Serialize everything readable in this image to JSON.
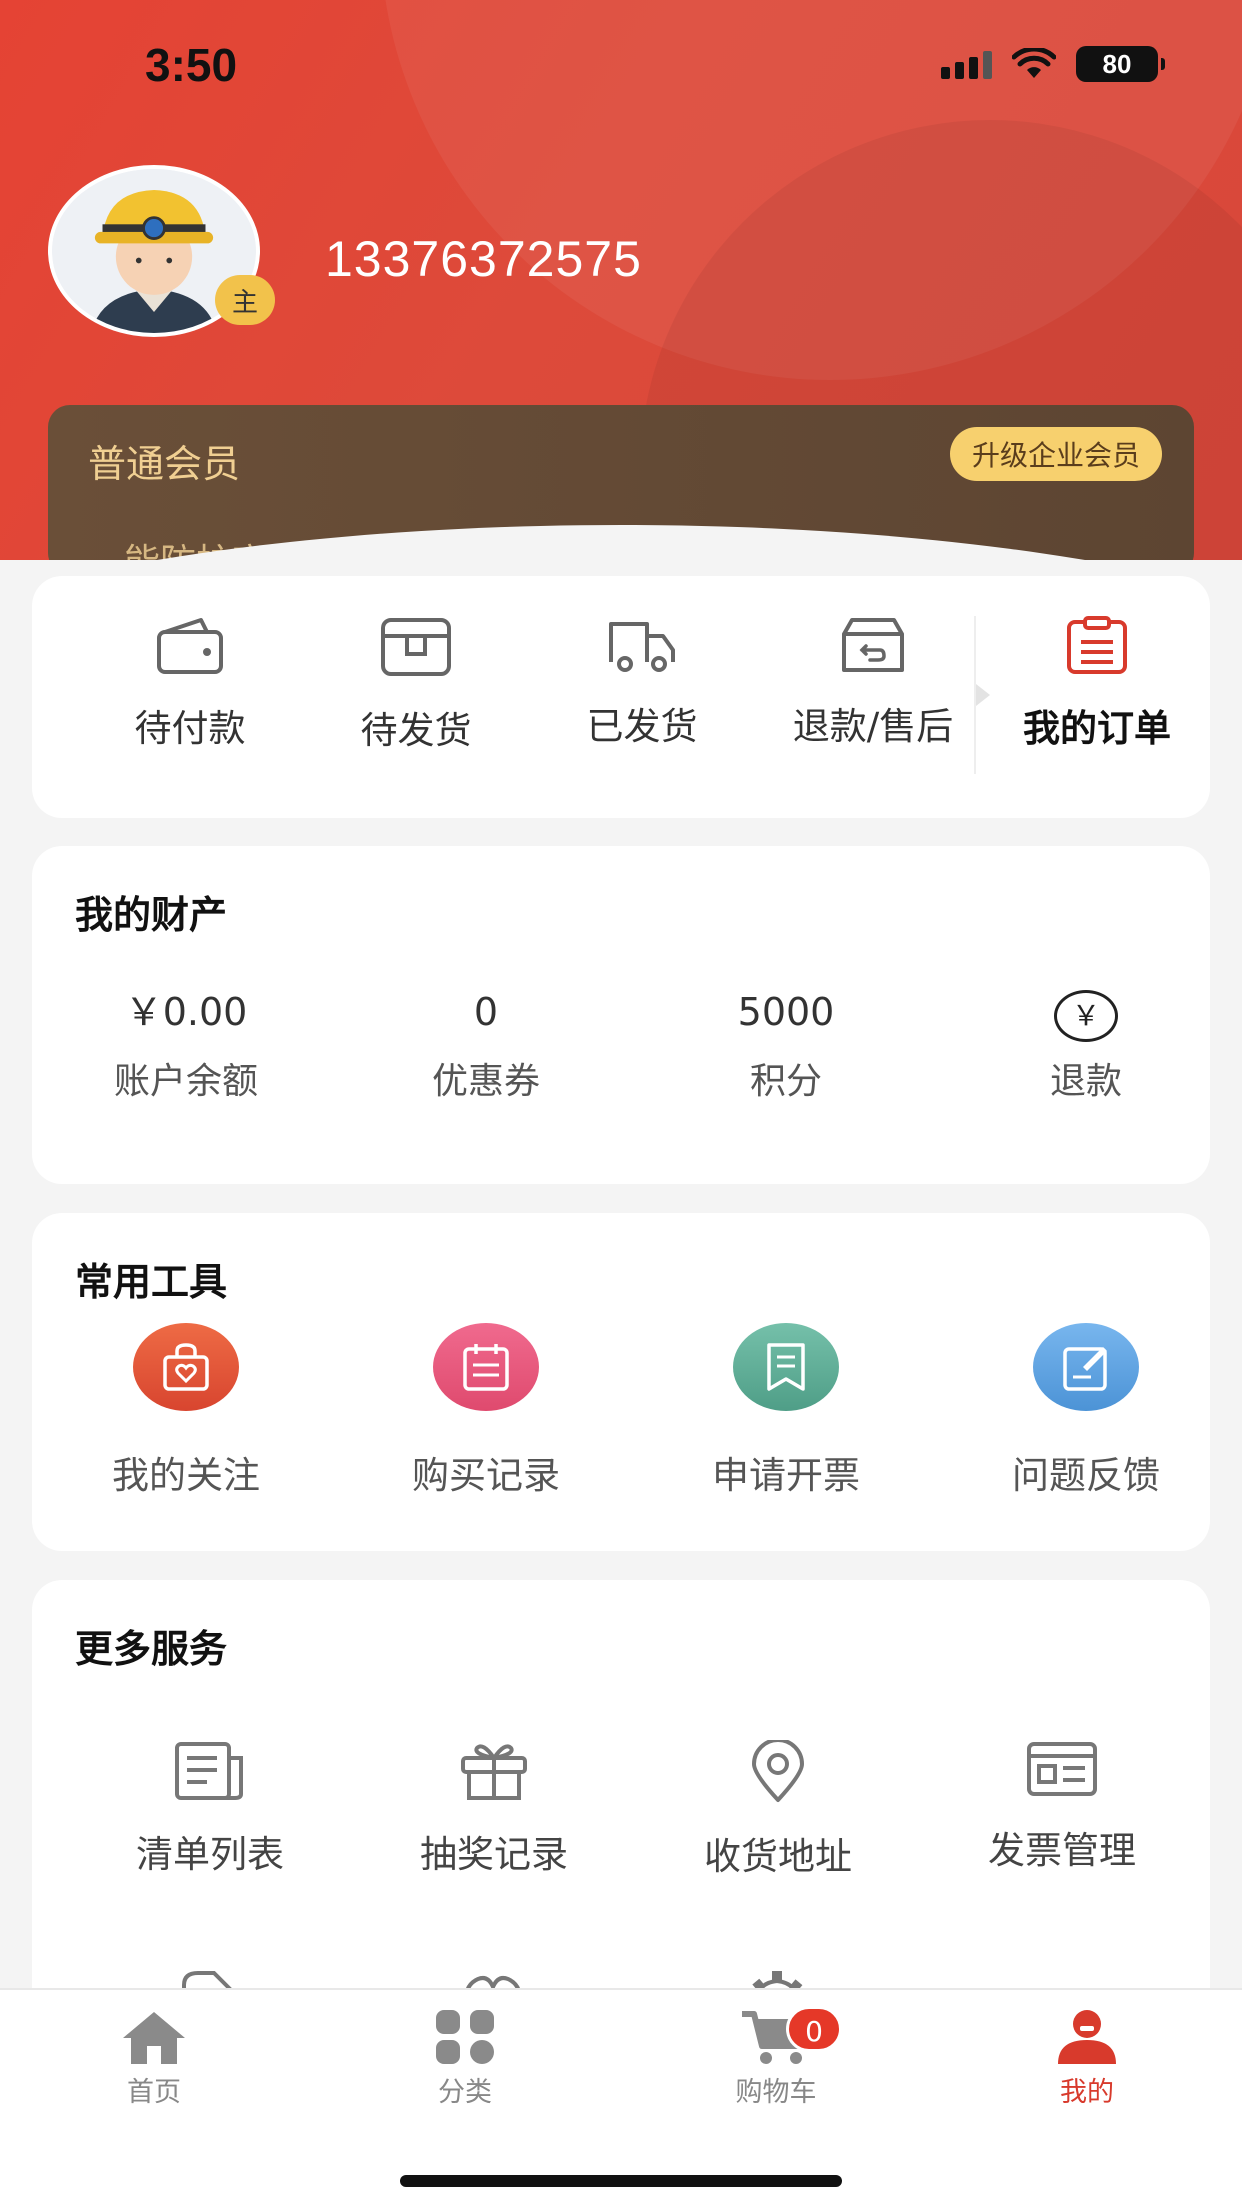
{
  "status_bar": {
    "time": "3:50",
    "battery": "80"
  },
  "profile": {
    "role_badge": "主",
    "phone": "13376372575"
  },
  "membership": {
    "level": "普通会员",
    "upgrade_label": "升级企业会员",
    "subtitle": "…能防护商城"
  },
  "orders": {
    "items": [
      {
        "label": "待付款",
        "icon": "wallet-icon"
      },
      {
        "label": "待发货",
        "icon": "box-icon"
      },
      {
        "label": "已发货",
        "icon": "truck-icon"
      },
      {
        "label": "退款/售后",
        "icon": "return-icon"
      }
    ],
    "my_orders_label": "我的订单"
  },
  "assets": {
    "title": "我的财产",
    "items": [
      {
        "value": "￥0.00",
        "label": "账户余额"
      },
      {
        "value": "0",
        "label": "优惠券"
      },
      {
        "value": "5000",
        "label": "积分"
      },
      {
        "symbol": "￥",
        "label": "退款"
      }
    ]
  },
  "tools": {
    "title": "常用工具",
    "items": [
      {
        "label": "我的关注",
        "icon": "heart-bag-icon",
        "color": "#e0543b"
      },
      {
        "label": "购买记录",
        "icon": "calendar-icon",
        "color": "#e4527a"
      },
      {
        "label": "申请开票",
        "icon": "bookmark-icon",
        "color": "#5fae98"
      },
      {
        "label": "问题反馈",
        "icon": "edit-note-icon",
        "color": "#5ba2df"
      }
    ]
  },
  "services": {
    "title": "更多服务",
    "items": [
      {
        "label": "清单列表",
        "icon": "list-doc-icon"
      },
      {
        "label": "抽奖记录",
        "icon": "gift-icon"
      },
      {
        "label": "收货地址",
        "icon": "location-pin-icon"
      },
      {
        "label": "发票管理",
        "icon": "invoice-icon"
      }
    ]
  },
  "tabbar": {
    "items": [
      {
        "label": "首页",
        "icon": "home-icon"
      },
      {
        "label": "分类",
        "icon": "grid-icon"
      },
      {
        "label": "购物车",
        "icon": "cart-icon"
      },
      {
        "label": "我的",
        "icon": "user-icon"
      }
    ],
    "cart_count": "0",
    "active_color": "#d83a2c"
  }
}
